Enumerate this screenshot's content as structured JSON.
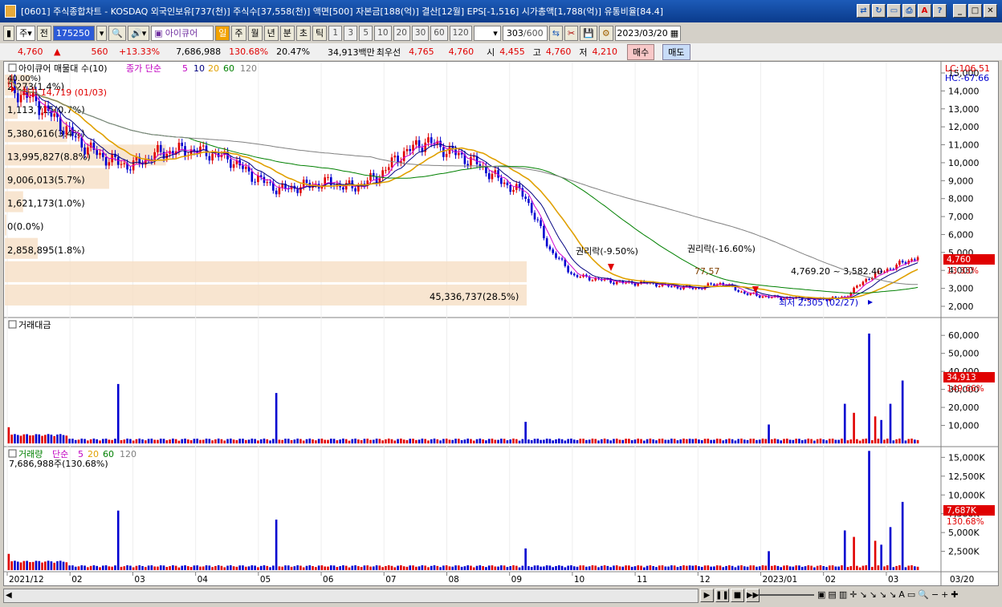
{
  "window": {
    "title": "[0601] 주식종합차트 - KOSDAQ 외국인보유[737(천)] 주식수[37,558(천)] 액면[500] 자본금[188(억)] 결산[12월] EPS[-1,516] 시가총액[1,788(억)] 유통비율[84.4]"
  },
  "toolbar": {
    "market": "주",
    "prev_label": "전",
    "code": "175250",
    "indicator": "아이큐어",
    "period_buttons": [
      "일",
      "주",
      "월",
      "년",
      "분",
      "초",
      "틱"
    ],
    "interval_buttons": [
      "1",
      "3",
      "5",
      "10",
      "20",
      "30",
      "60",
      "120"
    ],
    "count": "303",
    "count_max": "/600",
    "date": "2023/03/20"
  },
  "quote": {
    "price": "4,760",
    "arrow": "▲",
    "change": "560",
    "change_pct": "+13.33%",
    "volume": "7,686,988",
    "vol_ratio": "130.68%",
    "turnover": "20.47%",
    "amount": "34,913백만",
    "best_label": "최우선",
    "best_ask": "4,765",
    "best_bid": "4,760",
    "open_label": "시",
    "open": "4,455",
    "high_label": "고",
    "high": "4,760",
    "low_label": "저",
    "low": "4,210",
    "buy_label": "매수",
    "sell_label": "매도"
  },
  "price_panel": {
    "title": "아이큐어 매물대 수(10)",
    "ma_label": "종가 단순",
    "ma_periods": [
      "5",
      "10",
      "20",
      "60",
      "120"
    ],
    "lc": "LC:106.51",
    "hc": "HC:-67.66",
    "max_label": "최고 14,719 (01/03)",
    "min_label": "최저 2,305 (02/27)",
    "event1": "권리락(-9.50%)",
    "event2": "권리락(-16.60%)",
    "cur_price": "4,760",
    "cur_pct": "13.33%",
    "small_top": "40.00%)",
    "mid_label": "77,57",
    "range_label": "4,769.20 ~ 3,582.40",
    "volume_profile": [
      {
        "label": "2,273(1.4%)",
        "pct": 1.4
      },
      {
        "label": "1,113,715(0.7%)",
        "pct": 0.7
      },
      {
        "label": "5,380,616(3.4%)",
        "pct": 3.4
      },
      {
        "label": "13,995,827(8.8%)",
        "pct": 8.8
      },
      {
        "label": "9,006,013(5.7%)",
        "pct": 5.7
      },
      {
        "label": "1,621,173(1.0%)",
        "pct": 1.0
      },
      {
        "label": "0(0.0%)",
        "pct": 0.0
      },
      {
        "label": "2,858,895(1.8%)",
        "pct": 1.8
      },
      {
        "label": "",
        "pct": 28.5
      },
      {
        "label": "45,336,737(28.5%)",
        "pct": 28.5
      }
    ],
    "y_ticks": [
      "15,000",
      "14,000",
      "13,000",
      "12,000",
      "11,000",
      "10,000",
      "9,000",
      "8,000",
      "7,000",
      "6,000",
      "5,000",
      "4,000",
      "3,000",
      "2,000"
    ]
  },
  "amount_panel": {
    "title": "거래대금",
    "cur": "34,913",
    "cur_pct": "149.66%",
    "y_ticks": [
      "60,000",
      "50,000",
      "40,000",
      "30,000",
      "20,000",
      "10,000"
    ]
  },
  "volume_panel": {
    "title": "거래량",
    "ma_label": "단순",
    "ma_periods": [
      "5",
      "20",
      "60",
      "120"
    ],
    "info": "7,686,988주(130.68%)",
    "cur": "7,687K",
    "cur_pct": "130.68%",
    "y_ticks": [
      "15,000K",
      "12,500K",
      "10,000K",
      "7,500K",
      "5,000K",
      "2,500K"
    ]
  },
  "x_axis": {
    "labels": [
      "2021/12",
      "02",
      "03",
      "04",
      "05",
      "06",
      "07",
      "08",
      "09",
      "10",
      "11",
      "12",
      "2023/01",
      "02",
      "03"
    ],
    "right_label": "03/20"
  },
  "colors": {
    "up": "#e00000",
    "down": "#0000d0",
    "ma5": "#d000d0",
    "ma10": "#000080",
    "ma20": "#e0a000",
    "ma60": "#008000",
    "ma120": "#808080"
  },
  "chart_data": {
    "type": "candlestick",
    "price_range": [
      2000,
      15000
    ],
    "close_points": [
      14200,
      13500,
      12300,
      11000,
      10200,
      9800,
      10500,
      10700,
      10600,
      10200,
      9200,
      8500,
      8700,
      8900,
      8600,
      9200,
      10500,
      11200,
      10600,
      10000,
      9000,
      8200,
      5200,
      3700,
      3500,
      3300,
      3300,
      3100,
      3000,
      3300,
      2700,
      2500,
      2450,
      2400,
      2500,
      3600,
      4200,
      4760
    ]
  }
}
